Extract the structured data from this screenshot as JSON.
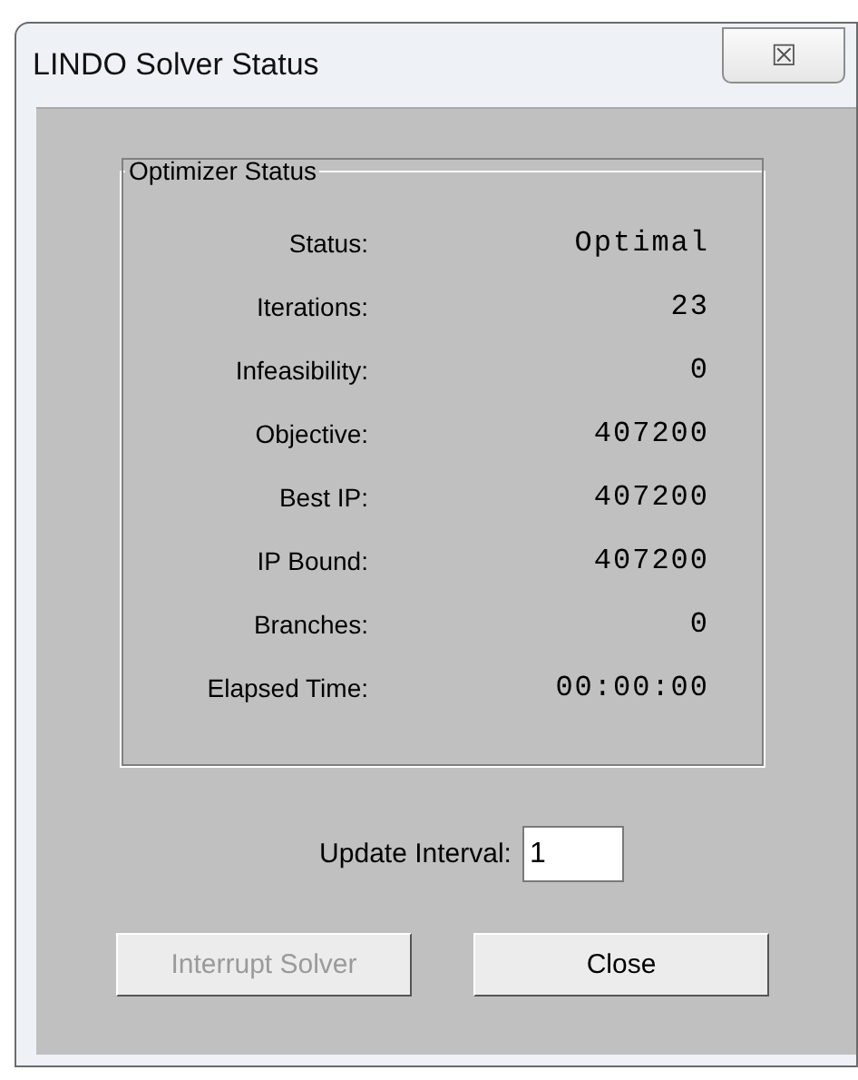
{
  "window": {
    "title": "LINDO Solver Status",
    "close_glyph": "☒"
  },
  "group": {
    "title": "Optimizer Status",
    "rows": [
      {
        "label": "Status:",
        "value": "Optimal"
      },
      {
        "label": "Iterations:",
        "value": "23"
      },
      {
        "label": "Infeasibility:",
        "value": "0"
      },
      {
        "label": "Objective:",
        "value": "407200"
      },
      {
        "label": "Best IP:",
        "value": "407200"
      },
      {
        "label": "IP Bound:",
        "value": "407200"
      },
      {
        "label": "Branches:",
        "value": "0"
      },
      {
        "label": "Elapsed Time:",
        "value": "00:00:00"
      }
    ]
  },
  "update_interval": {
    "label": "Update Interval:",
    "value": "1"
  },
  "buttons": [
    {
      "label": "Interrupt Solver",
      "disabled": true
    },
    {
      "label": "Close",
      "disabled": false
    }
  ]
}
